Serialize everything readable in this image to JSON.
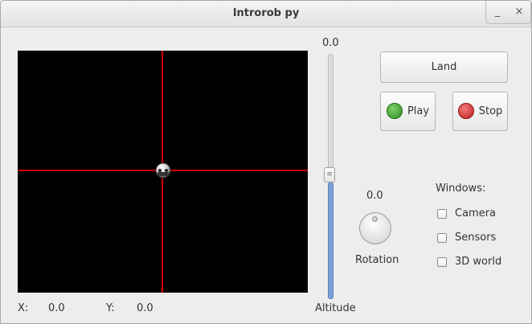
{
  "window": {
    "title": "Introrob py",
    "minimize_glyph": "_",
    "close_glyph": "×"
  },
  "coords": {
    "x_label": "X:",
    "x_value": "0.0",
    "y_label": "Y:",
    "y_value": "0.0"
  },
  "altitude": {
    "value": "0.0",
    "label": "Altitude"
  },
  "buttons": {
    "land": "Land",
    "play": "Play",
    "stop": "Stop"
  },
  "rotation": {
    "value": "0.0",
    "label": "Rotation"
  },
  "windows": {
    "title": "Windows:",
    "items": [
      {
        "label": "Camera",
        "checked": false
      },
      {
        "label": "Sensors",
        "checked": false
      },
      {
        "label": "3D world",
        "checked": false
      }
    ]
  },
  "colors": {
    "crosshair": "#d10000",
    "canvas_bg": "#000000",
    "slider_fill": "#7aa2d8"
  }
}
